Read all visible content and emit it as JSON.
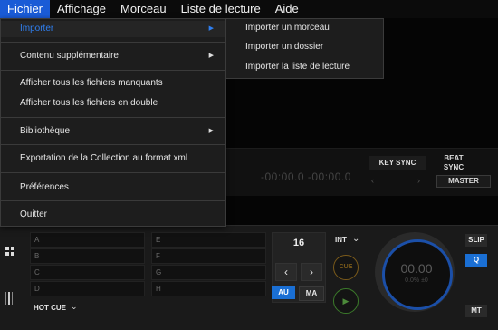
{
  "menubar": {
    "items": [
      {
        "label": "Fichier"
      },
      {
        "label": "Affichage"
      },
      {
        "label": "Morceau"
      },
      {
        "label": "Liste de lecture"
      },
      {
        "label": "Aide"
      }
    ]
  },
  "file_menu": {
    "items": [
      {
        "label": "Importer",
        "submenu": true
      },
      {
        "label": "Contenu supplémentaire",
        "submenu": true
      },
      {
        "label": "Afficher tous les fichiers manquants"
      },
      {
        "label": "Afficher tous les fichiers en double"
      },
      {
        "label": "Bibliothèque",
        "submenu": true
      },
      {
        "label": "Exportation de la Collection au format xml"
      },
      {
        "label": "Préférences"
      },
      {
        "label": "Quitter"
      }
    ]
  },
  "import_submenu": {
    "items": [
      {
        "label": "Importer un morceau"
      },
      {
        "label": "Importer un dossier"
      },
      {
        "label": "Importer la liste de lecture"
      }
    ]
  },
  "deck": {
    "time_readout": "-00:00.0 -00:00.0",
    "key_sync": "KEY SYNC",
    "beat_sync": "BEAT\nSYNC",
    "master": "MASTER",
    "hot_cue_label": "HOT CUE",
    "hot_cues": [
      "A",
      "B",
      "C",
      "D",
      "E",
      "F",
      "G",
      "H"
    ],
    "beat_value": "16",
    "au": "AU",
    "ma": "MA",
    "int": "INT",
    "cue": "CUE",
    "jog_time": "00.00",
    "jog_pitch": "0.0% ±0",
    "slip": "SLIP",
    "q": "Q",
    "mt": "MT"
  },
  "colors": {
    "menu_active": "#1a5bd6",
    "accent_blue": "#1a6fd4",
    "highlight_text": "#2f7ff0"
  }
}
